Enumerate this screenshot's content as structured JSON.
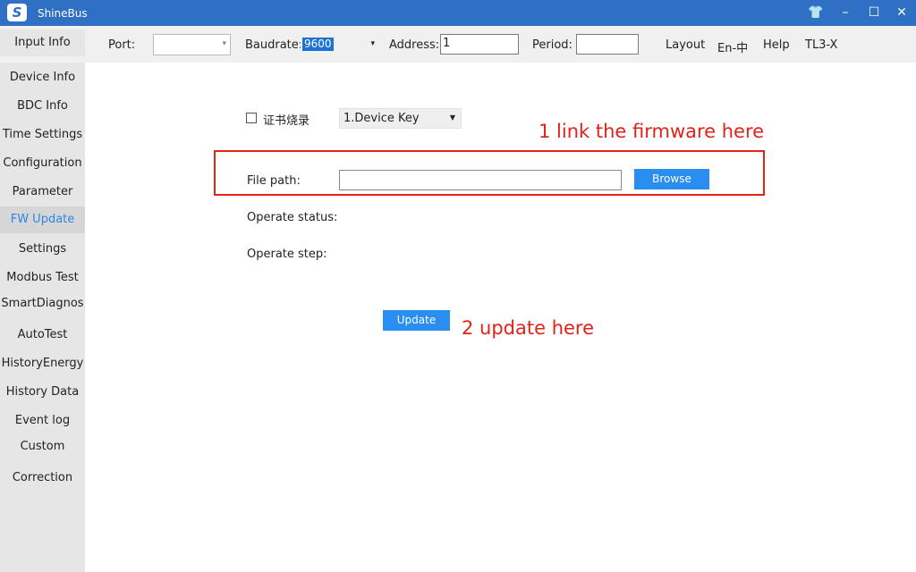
{
  "window": {
    "title": "ShineBus",
    "logo_letter": "S",
    "controls": {
      "skin": "👕",
      "minimize": "–",
      "maximize": "☐",
      "close": "✕"
    }
  },
  "toolbar": {
    "port_label": "Port:",
    "port_value": "",
    "baudrate_label": "Baudrate:",
    "baudrate_value": "9600",
    "address_label": "Address:",
    "address_value": "1",
    "period_label": "Period:",
    "period_value": "",
    "links": {
      "layout": "Layout",
      "language": "En-中",
      "help": "Help",
      "model": "TL3-X"
    }
  },
  "sidebar": {
    "input_info": "Input Info",
    "items": [
      {
        "label": "Device Info"
      },
      {
        "label": "BDC Info"
      },
      {
        "label": "Time Settings"
      },
      {
        "label": "Configuration"
      },
      {
        "label": "Parameter"
      },
      {
        "label": "FW Update",
        "active": true
      },
      {
        "label": "Settings"
      },
      {
        "label": "Modbus Test"
      },
      {
        "label": "SmartDiagnos"
      },
      {
        "label": "AutoTest"
      },
      {
        "label": "HistoryEnergy"
      },
      {
        "label": "History Data"
      },
      {
        "label": "Event log"
      },
      {
        "label": "Custom"
      },
      {
        "label": "Correction"
      }
    ]
  },
  "fw_update": {
    "cert_checkbox_label": "证书烧录",
    "cert_checked": false,
    "key_select_value": "1.Device Key",
    "file_path_label": "File path:",
    "file_path_value": "",
    "browse_label": "Browse",
    "operate_status_label": "Operate status:",
    "operate_step_label": "Operate step:",
    "update_label": "Update"
  },
  "annotations": {
    "step1": "1 link the firmware here",
    "step2": "2 update here",
    "color": "#e2231a"
  },
  "colors": {
    "titlebar": "#2f6fc4",
    "button": "#2a8df0",
    "active_tab_text": "#2a86e8"
  }
}
